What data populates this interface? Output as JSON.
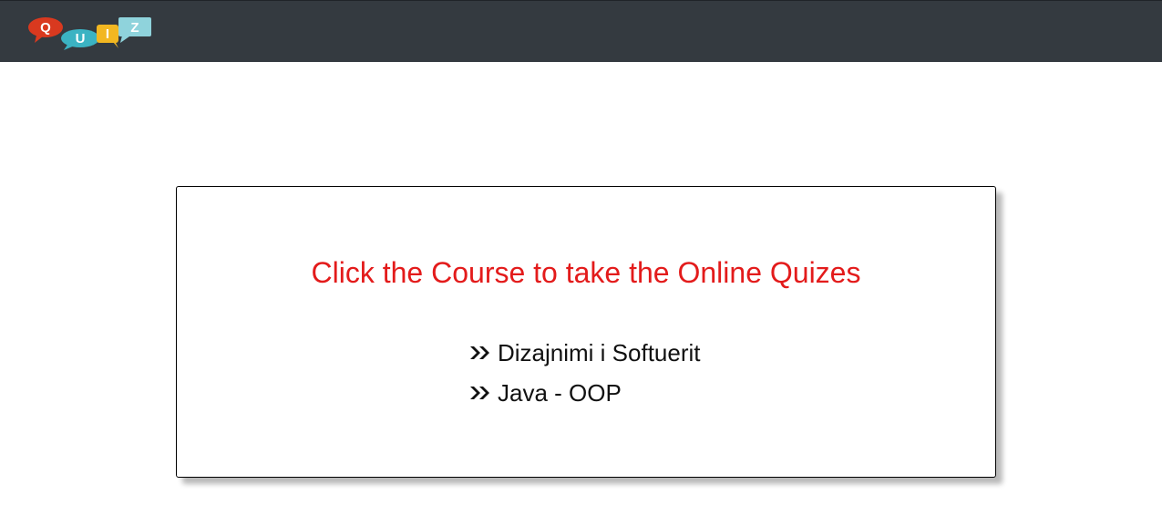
{
  "navbar": {
    "logo": {
      "icon": "quiz-logo-icon",
      "letters": [
        "Q",
        "U",
        "I",
        "Z"
      ],
      "colors": [
        "#d9391f",
        "#3bb3c3",
        "#f2b721",
        "#8fd3dc"
      ]
    }
  },
  "main": {
    "heading": "Click the Course to take the Online Quizes",
    "heading_color": "#e31b1b",
    "courses": [
      {
        "label": "Dizajnimi i Softuerit",
        "icon": "double-chevron-right-icon"
      },
      {
        "label": "Java - OOP",
        "icon": "double-chevron-right-icon"
      }
    ]
  }
}
